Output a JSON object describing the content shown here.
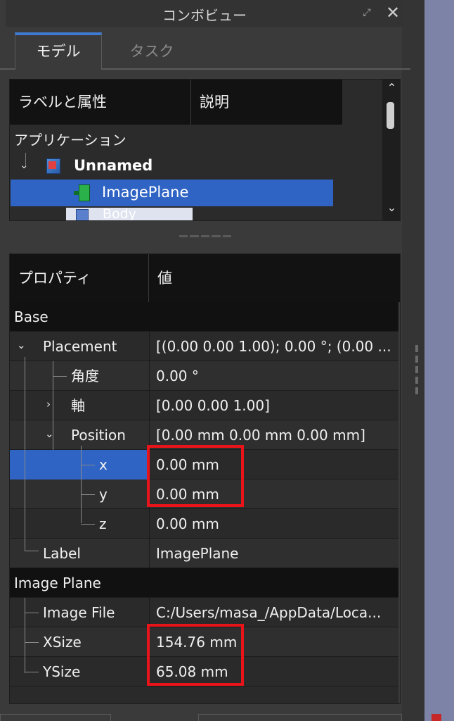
{
  "window": {
    "title": "コンボビュー",
    "float_icon": "⤢",
    "close_icon": "✕"
  },
  "tabs": [
    {
      "label": "モデル",
      "active": true
    },
    {
      "label": "タスク",
      "active": false
    }
  ],
  "tree": {
    "headers": {
      "label": "ラベルと属性",
      "description": "説明"
    },
    "root": "アプリケーション",
    "document": "Unnamed",
    "selected_item": "ImagePlane",
    "next_item": "Body",
    "scroll_up": "⌃",
    "scroll_down": "⌄"
  },
  "properties": {
    "headers": {
      "name": "プロパティ",
      "value": "値"
    },
    "groups": [
      {
        "name": "Base",
        "rows": [
          {
            "name": "Placement",
            "value": "[(0.00 0.00 1.00); 0.00 °; (0.00 ..."
          },
          {
            "name": "角度",
            "value": "0.00 °"
          },
          {
            "name": "軸",
            "value": "[0.00 0.00 1.00]"
          },
          {
            "name": "Position",
            "value": "[0.00 mm  0.00 mm  0.00 mm]"
          },
          {
            "name": "x",
            "value": "0.00 mm"
          },
          {
            "name": "y",
            "value": "0.00 mm"
          },
          {
            "name": "z",
            "value": "0.00 mm"
          },
          {
            "name": "Label",
            "value": "ImagePlane"
          }
        ]
      },
      {
        "name": "Image Plane",
        "rows": [
          {
            "name": "Image File",
            "value": "C:/Users/masa_/AppData/Loca..."
          },
          {
            "name": "XSize",
            "value": "154.76 mm"
          },
          {
            "name": "YSize",
            "value": "65.08 mm"
          }
        ]
      }
    ]
  },
  "colors": {
    "selection": "#2f64c4",
    "highlight": "#e8141a",
    "active_tab": "#3f7bd3"
  }
}
